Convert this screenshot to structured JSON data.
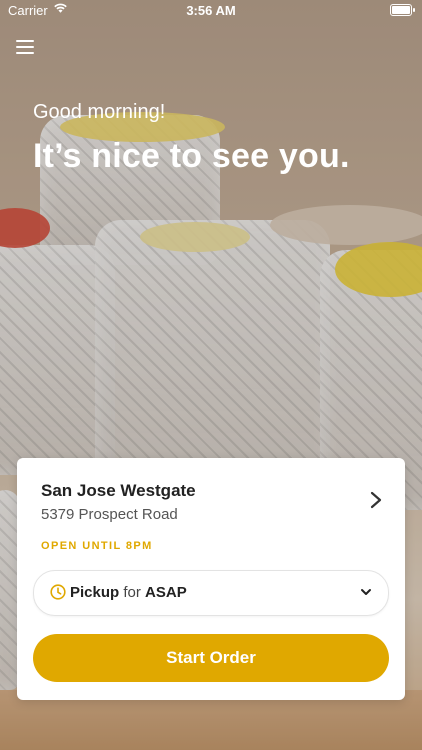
{
  "status_bar": {
    "carrier": "Carrier",
    "time": "3:56 AM"
  },
  "hero": {
    "greeting": "Good morning!",
    "headline": "It’s nice to see you."
  },
  "store_card": {
    "name": "San Jose Westgate",
    "address": "5379 Prospect Road",
    "hours": "OPEN UNTIL 8PM",
    "pickup": {
      "mode": "Pickup",
      "connector": "for",
      "time": "ASAP"
    },
    "start_label": "Start Order"
  },
  "colors": {
    "accent": "#e0a800",
    "card_bg": "#ffffff",
    "text_primary": "#222222"
  },
  "icons": [
    "menu-icon",
    "wifi-icon",
    "battery-icon",
    "chevron-right-icon",
    "clock-icon",
    "chevron-down-icon"
  ]
}
